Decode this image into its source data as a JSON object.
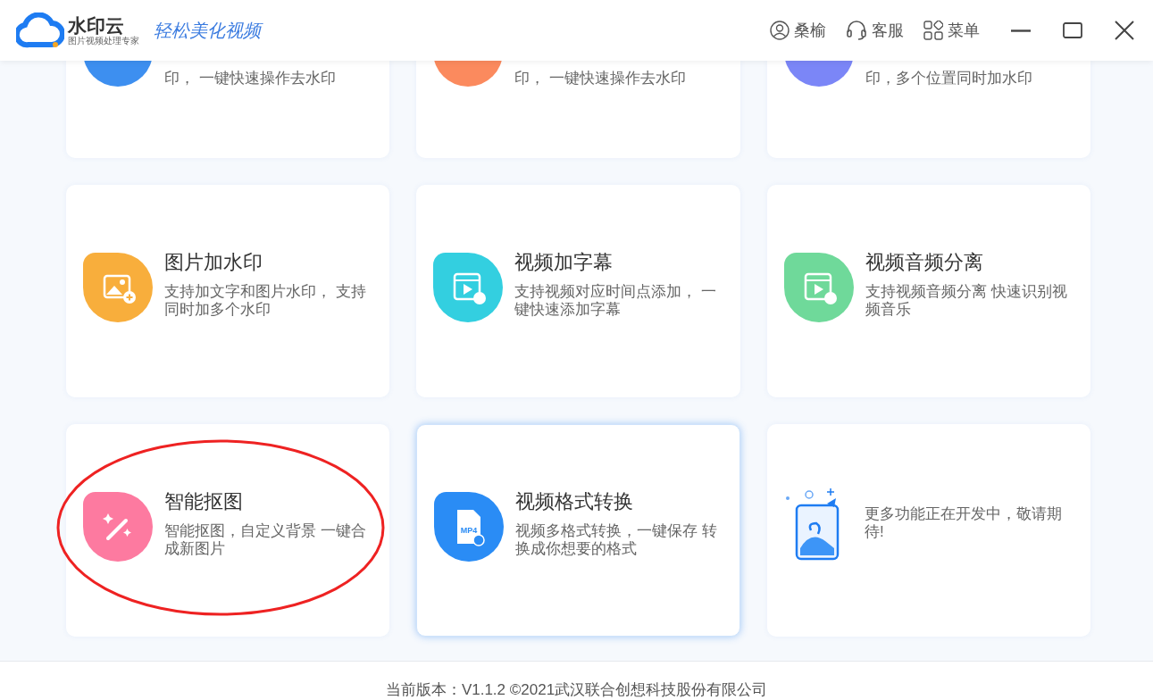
{
  "header": {
    "logo_name": "水印云",
    "logo_tagline": "图片视频处理专家",
    "slogan": "轻松美化视频",
    "actions": [
      {
        "kind": "user",
        "label": "桑榆"
      },
      {
        "kind": "support",
        "label": "客服"
      },
      {
        "kind": "menu",
        "label": "菜单"
      }
    ]
  },
  "partial_cards": [
    {
      "color": "#3d8ff0",
      "description": "印， 一键快速操作去水印"
    },
    {
      "color": "#fb8a5e",
      "description": "印， 一键快速操作去水印"
    },
    {
      "color": "#7b86f7",
      "description": "印，多个位置同时加水印"
    }
  ],
  "cards": [
    {
      "kind": "feature",
      "color": "#f8ae3c",
      "title": "图片加水印",
      "description": "支持加文字和图片水印， 支持同时加多个水印",
      "hovered": false,
      "highlighted": false
    },
    {
      "kind": "feature",
      "color": "#33cfe0",
      "title": "视频加字幕",
      "description": "支持视频对应时间点添加， 一键快速添加字幕",
      "hovered": false,
      "highlighted": false
    },
    {
      "kind": "feature",
      "color": "#6fd99a",
      "title": "视频音频分离",
      "description": "支持视频音频分离 快速识别视频音乐",
      "hovered": false,
      "highlighted": false
    },
    {
      "kind": "feature",
      "color": "#fd7aa0",
      "title": "智能抠图",
      "description": "智能抠图，自定义背景 一键合成新图片",
      "hovered": false,
      "highlighted": true
    },
    {
      "kind": "feature",
      "color": "#2a8cf5",
      "title": "视频格式转换",
      "icon_text": "MP4",
      "description": "视频多格式转换，一键保存 转换成你想要的格式",
      "hovered": true,
      "highlighted": false
    },
    {
      "kind": "coming_soon",
      "description": "更多功能正在开发中，敬请期待!",
      "hovered": false,
      "highlighted": false
    }
  ],
  "footer": {
    "text": "当前版本：V1.1.2 ©2021武汉联合创想科技股份有限公司"
  }
}
